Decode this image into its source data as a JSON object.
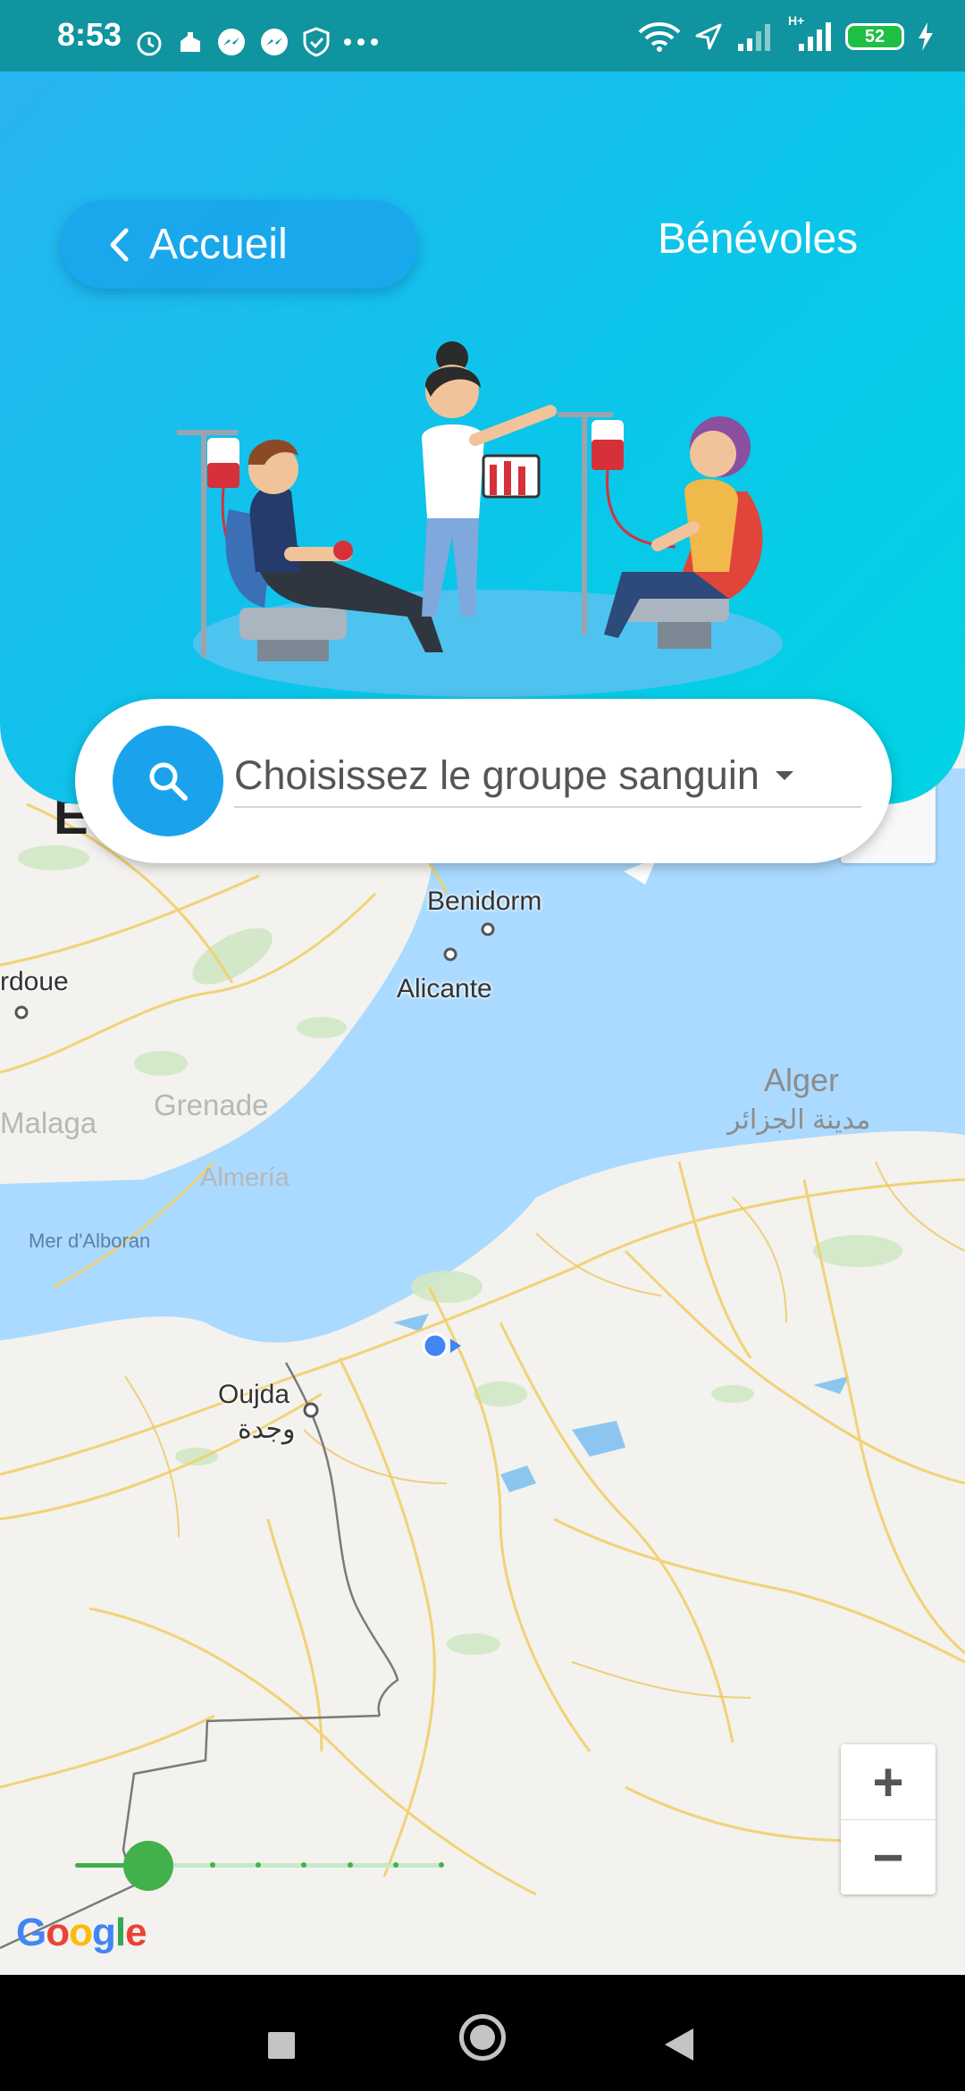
{
  "status_bar": {
    "time": "8:53",
    "battery": "52",
    "network": "H+"
  },
  "header": {
    "back_label": "Accueil",
    "volunteers_label": "Bénévoles"
  },
  "search": {
    "placeholder": "Choisissez le groupe sanguin"
  },
  "map": {
    "cities": {
      "benidorm": "Benidorm",
      "alicante": "Alicante",
      "cordoue": "rdoue",
      "malaga": "Malaga",
      "grenade": "Grenade",
      "almeria": "Almería",
      "alger": "Alger",
      "alger_ar": "مدينة الجزائر",
      "oujda": "Oujda",
      "oujda_ar": "وجدة"
    },
    "sea_label": "Mer d'Alboran",
    "partial_letter": "E",
    "attribution": "Google",
    "zoom_in": "+",
    "zoom_out": "−",
    "distance_slider_fraction": 0.2
  },
  "colors": {
    "header_gradient_start": "#2bb2f2",
    "header_gradient_end": "#00d4e3",
    "status_bar": "#10949f",
    "sea": "#aadaff",
    "slider": "#43b14b",
    "search_accent": "#1aa3ec"
  }
}
